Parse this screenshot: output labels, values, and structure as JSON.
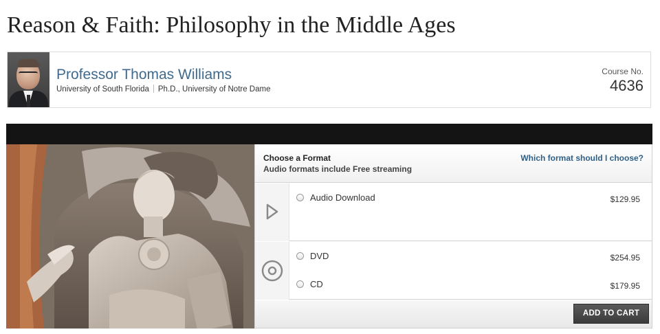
{
  "page": {
    "title": "Reason & Faith: Philosophy in the Middle Ages"
  },
  "professor": {
    "name": "Professor Thomas Williams",
    "institution": "University of South Florida",
    "degree": "Ph.D., University of Notre Dame"
  },
  "course": {
    "label": "Course No.",
    "number": "4636"
  },
  "purchase": {
    "heading": "Choose a Format",
    "subheading": "Audio formats include Free streaming",
    "help_link": "Which format should I choose?",
    "options": [
      {
        "label": "Audio Download",
        "price": "$129.95",
        "icon": "play-triangle-icon"
      },
      {
        "label": "DVD",
        "price": "$254.95",
        "icon": "disc-icon"
      },
      {
        "label": "CD",
        "price": "$179.95",
        "icon": "disc-icon"
      }
    ],
    "add_to_cart": "ADD TO CART"
  },
  "colors": {
    "link_blue": "#3f6a8d",
    "help_blue": "#2f5f86",
    "black_bar": "#141414",
    "button_dark": "#3b3b3b"
  }
}
